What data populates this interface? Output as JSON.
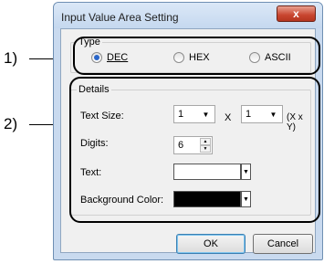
{
  "annotations": [
    "1)",
    "2)"
  ],
  "window": {
    "title": "Input Value Area Setting",
    "close_label": "x"
  },
  "type_group": {
    "label": "Type",
    "options": [
      "DEC",
      "HEX",
      "ASCII"
    ],
    "selected": "DEC"
  },
  "details_group": {
    "label": "Details",
    "text_size_label": "Text Size:",
    "text_size_x": "1",
    "text_size_y": "1",
    "x_sep": "X",
    "xy_unit": "(X x Y)",
    "digits_label": "Digits:",
    "digits_value": "6",
    "text_label": "Text:",
    "text_color": "#ffffff",
    "bg_label": "Background Color:",
    "bg_color": "#000000"
  },
  "buttons": {
    "ok": "OK",
    "cancel": "Cancel"
  }
}
